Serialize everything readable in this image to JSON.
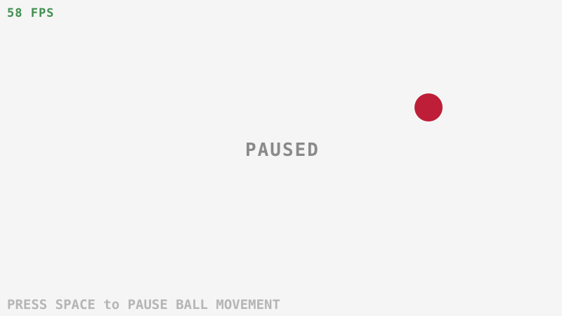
{
  "hud": {
    "fps_text": "58 FPS"
  },
  "status": {
    "paused_text": "PAUSED"
  },
  "instructions": {
    "text": "PRESS SPACE to PAUSE BALL MOVEMENT"
  },
  "colors": {
    "background": "#f5f5f5",
    "fps": "#3f8f4f",
    "ball": "#be1e37",
    "paused": "#8a8a8a",
    "instructions": "#b5b5b5"
  }
}
